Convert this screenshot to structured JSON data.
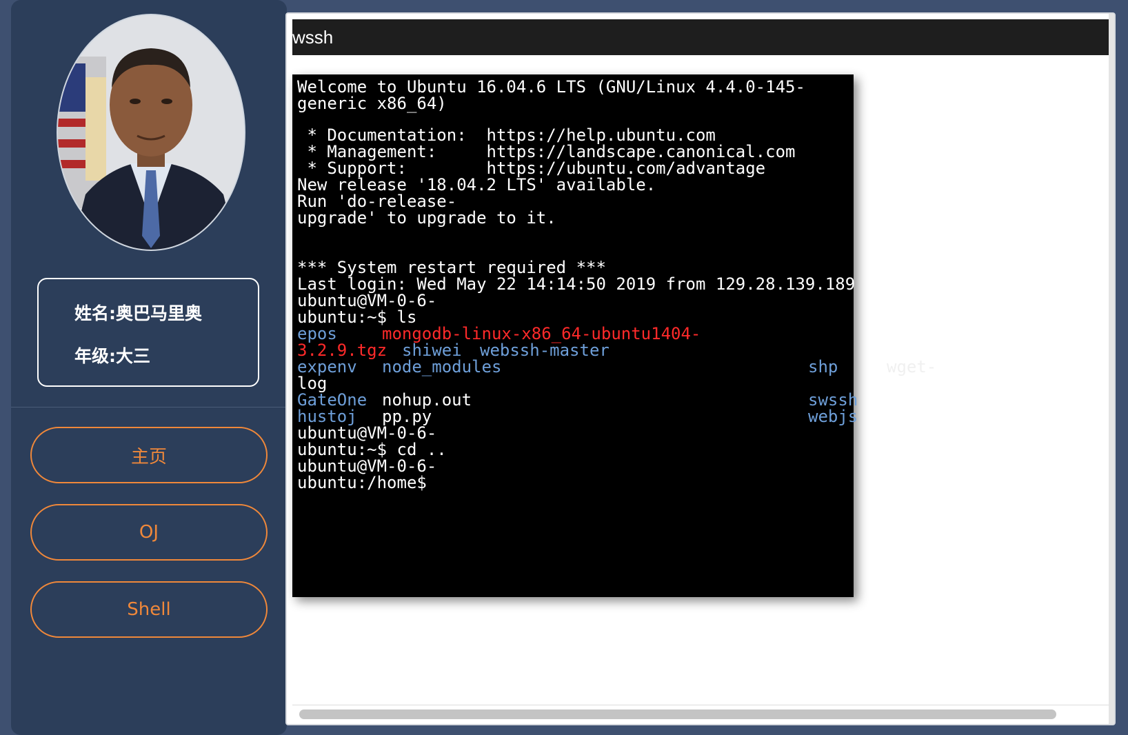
{
  "sidebar": {
    "name_label": "姓名:",
    "name_value": "奥巴马里奥",
    "grade_label": "年级:",
    "grade_value": "大三",
    "nav": [
      {
        "label": "主页"
      },
      {
        "label": "OJ"
      },
      {
        "label": "Shell"
      }
    ]
  },
  "window": {
    "title": "wssh"
  },
  "terminal": {
    "lines": {
      "l1": "Welcome to Ubuntu 16.04.6 LTS (GNU/Linux 4.4.0-145-",
      "l2": "generic x86_64)",
      "l3": " * Documentation:  https://help.ubuntu.com",
      "l4": " * Management:     https://landscape.canonical.com",
      "l5": " * Support:        https://ubuntu.com/advantage",
      "l6": "New release '18.04.2 LTS' available.",
      "l7": "Run 'do-release-",
      "l8": "upgrade' to upgrade to it.",
      "l9": "*** System restart required ***",
      "l10": "Last login: Wed May 22 14:14:50 2019 from 129.28.139.189",
      "l11": "ubuntu@VM-0-6-",
      "l12": "ubuntu:~$ ls",
      "l21": "ubuntu@VM-0-6-",
      "l22": "ubuntu:~$ cd ..",
      "l23": "ubuntu@VM-0-6-",
      "l24": "ubuntu:/home$"
    },
    "ls": {
      "epos": "epos",
      "mongodb_1": "mongodb-linux-x86_64-ubuntu1404-",
      "mongodb_2": "3.2.9.tgz",
      "shiwei": "shiwei",
      "webssh_master": "webssh-master",
      "expenv": "expenv",
      "node_modules": "node_modules",
      "shp": "shp",
      "wget": "wget-",
      "log": "log",
      "gateone": "GateOne",
      "nohup": "nohup.out",
      "swssh": "swssh",
      "hustoj": "hustoj",
      "pp": "pp.py",
      "webjs": "webjs"
    }
  }
}
